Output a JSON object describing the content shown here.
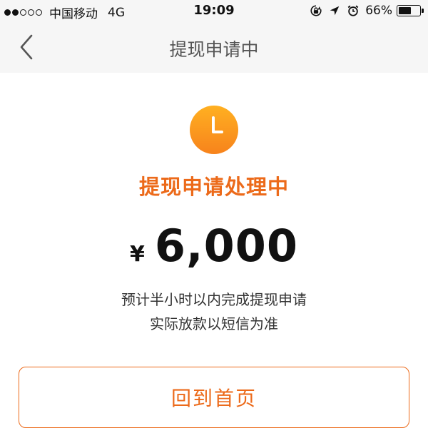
{
  "status_bar": {
    "carrier": "中国移动",
    "network": "4G",
    "time": "19:09",
    "battery_percent": "66%",
    "battery_level": 0.66,
    "signal_bars_filled": 2,
    "signal_bars_total": 5,
    "icons": [
      "rotation-lock-icon",
      "location-arrow-icon",
      "alarm-icon",
      "battery-icon"
    ]
  },
  "nav": {
    "title": "提现申请中",
    "back_icon": "chevron-left-icon"
  },
  "content": {
    "status_icon": "clock-icon",
    "status_title": "提现申请处理中",
    "currency_symbol": "¥",
    "amount": "6,000",
    "note_line1": "预计半小时以内完成提现申请",
    "note_line2": "实际放款以短信为准",
    "home_button_label": "回到首页"
  },
  "colors": {
    "accent": "#ec6a1a",
    "clock_gradient_top": "#ffb021",
    "clock_gradient_bottom": "#f7831c",
    "nav_background": "#f6f6f6"
  }
}
